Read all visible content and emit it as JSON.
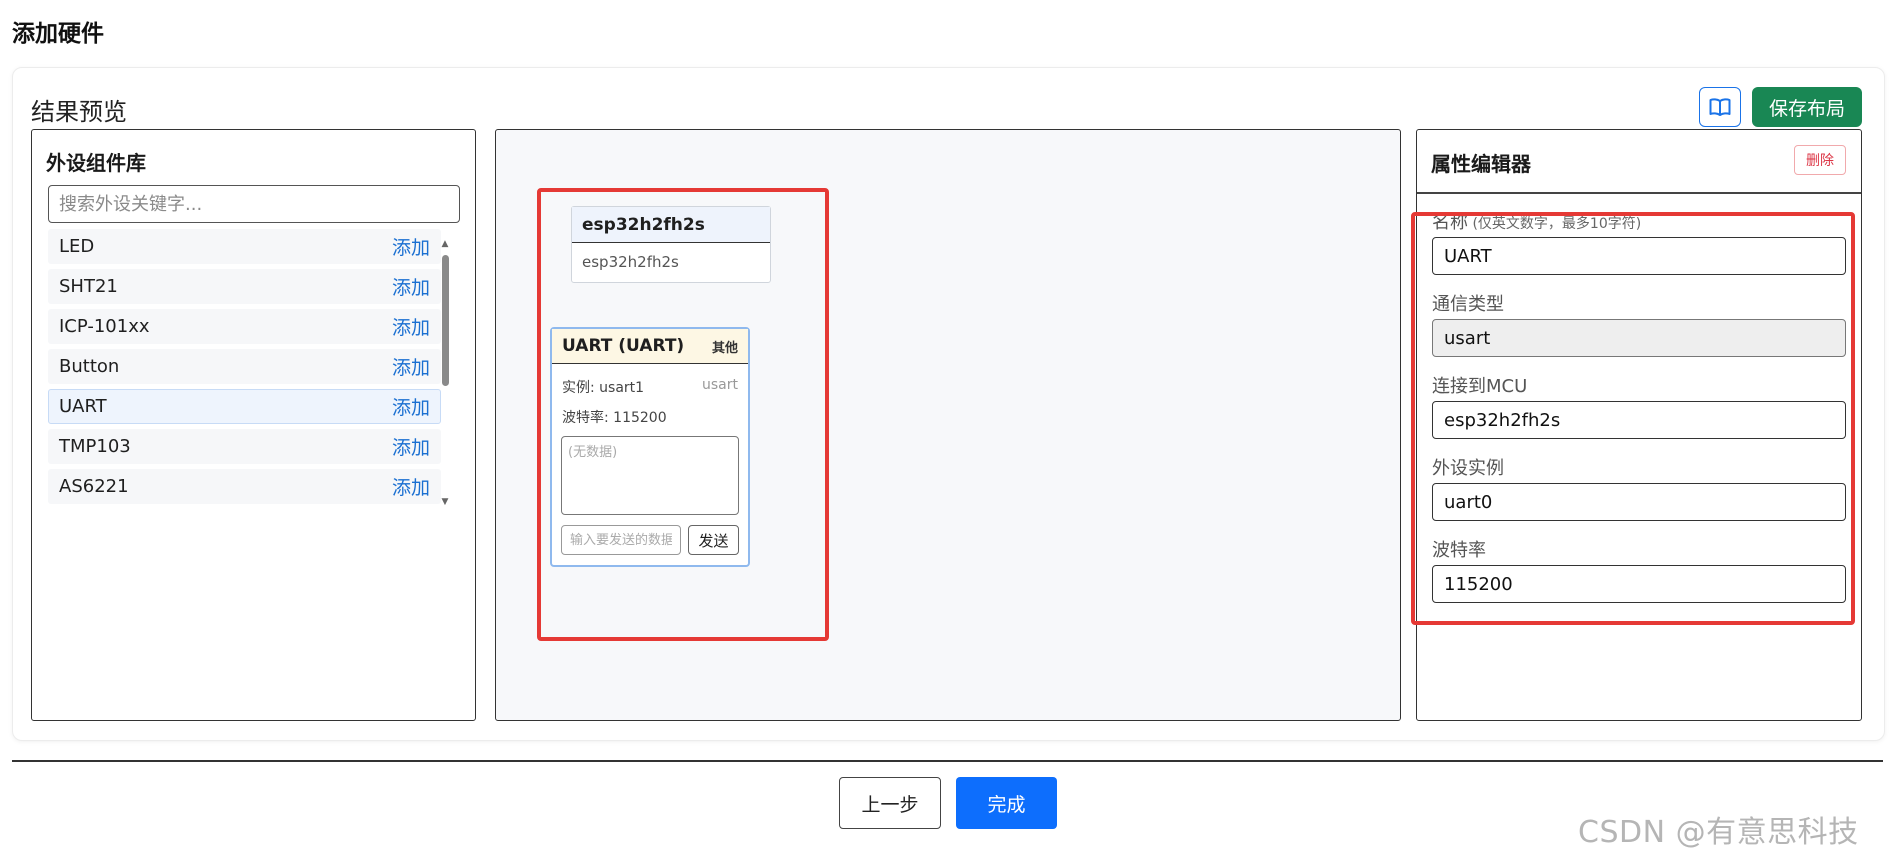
{
  "page_title": "添加硬件",
  "section_title": "结果预览",
  "toolbar": {
    "book_icon": "book-open-icon",
    "save_label": "保存布局",
    "save_color": "#198754"
  },
  "library": {
    "title": "外设组件库",
    "search_placeholder": "搜索外设关键字...",
    "add_label": "添加",
    "items": [
      {
        "name": "LED"
      },
      {
        "name": "SHT21"
      },
      {
        "name": "ICP-101xx"
      },
      {
        "name": "Button"
      },
      {
        "name": "UART"
      },
      {
        "name": "TMP103"
      },
      {
        "name": "AS6221"
      }
    ]
  },
  "canvas": {
    "mcu_node": {
      "title": "esp32h2fh2s",
      "body": "esp32h2fh2s"
    },
    "uart_node": {
      "title": "UART (UART)",
      "tag": "其他",
      "instance": "实例: usart1",
      "instance_type": "usart",
      "baud": "波特率: 115200",
      "data_placeholder": "(无数据)",
      "send_placeholder": "输入要发送的数据",
      "send_label": "发送"
    },
    "highlight_color": "#e53935"
  },
  "properties": {
    "title": "属性编辑器",
    "delete_label": "删除",
    "fields": {
      "name_label": "名称",
      "name_hint": " (仅英文数字，最多10字符)",
      "name_value": "UART",
      "comm_label": "通信类型",
      "comm_value": "usart",
      "mcu_label": "连接到MCU",
      "mcu_value": "esp32h2fh2s",
      "instance_label": "外设实例",
      "instance_value": "uart0",
      "baud_label": "波特率",
      "baud_value": "115200"
    }
  },
  "footer": {
    "prev_label": "上一步",
    "done_label": "完成",
    "done_color": "#0d6efd"
  },
  "watermark": "CSDN @有意思科技"
}
